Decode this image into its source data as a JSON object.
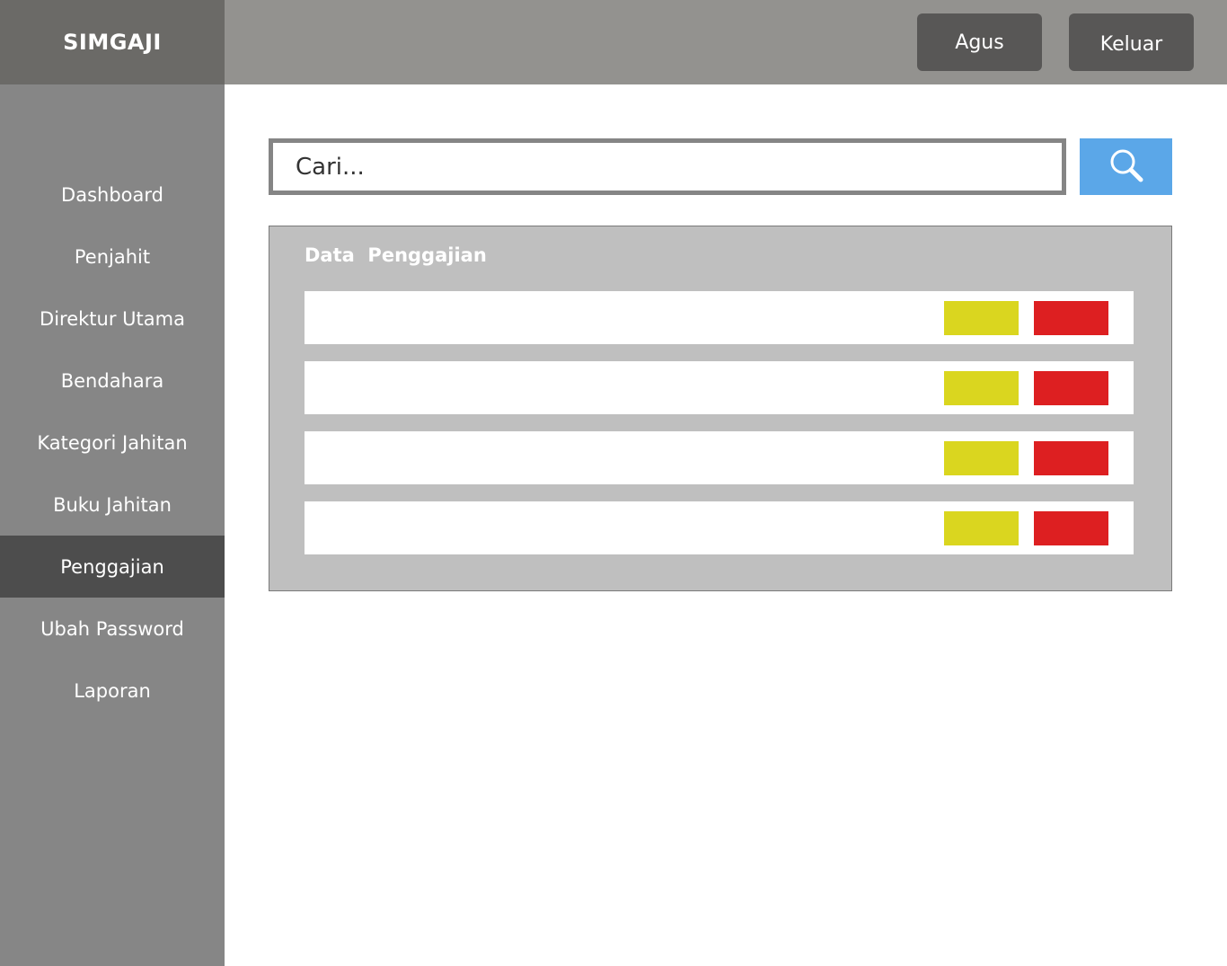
{
  "app": {
    "title": "SIMGAJI"
  },
  "header": {
    "user_label": "Agus",
    "logout_label": "Keluar"
  },
  "sidebar": {
    "items": [
      {
        "label": "Dashboard"
      },
      {
        "label": "Penjahit"
      },
      {
        "label": "Direktur Utama"
      },
      {
        "label": "Bendahara"
      },
      {
        "label": "Kategori Jahitan"
      },
      {
        "label": "Buku Jahitan"
      },
      {
        "label": "Penggajian",
        "active": true
      },
      {
        "label": "Ubah Password"
      },
      {
        "label": "Laporan"
      }
    ]
  },
  "search": {
    "placeholder": "Cari...",
    "icon": "search-icon"
  },
  "panel": {
    "title": "Data  Penggajian",
    "row_count": 4
  },
  "colors": {
    "accent": "#5ba7e8",
    "edit": "#dad61f",
    "delete": "#dd1f21",
    "sidebar_active": "#4d4d4d"
  }
}
